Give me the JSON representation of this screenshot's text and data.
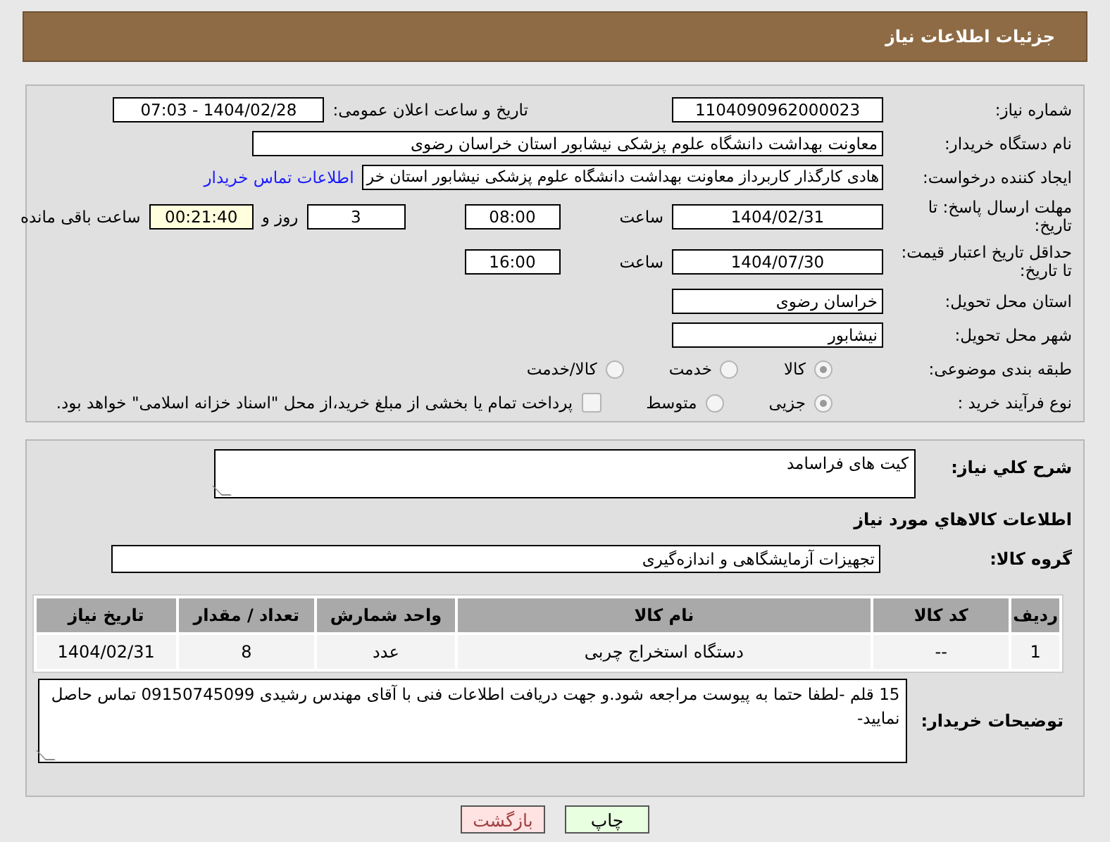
{
  "header": {
    "title": "جزئیات اطلاعات نیاز"
  },
  "need_number": {
    "label": "شماره نیاز:",
    "value": "1104090962000023"
  },
  "announce": {
    "label": "تاریخ و ساعت اعلان عمومی:",
    "value": "1404/02/28 - 07:03"
  },
  "buyer": {
    "label": "نام دستگاه خریدار:",
    "value": "معاونت بهداشت دانشگاه علوم پزشکی نیشابور استان خراسان رضوی"
  },
  "requester": {
    "label": "ایجاد کننده درخواست:",
    "value": "هادی کارگذار کاربرداز معاونت بهداشت دانشگاه علوم پزشکی نیشابور استان خر",
    "link": "اطلاعات تماس خریدار"
  },
  "deadline": {
    "label": "مهلت ارسال پاسخ: تا تاریخ:",
    "date": "1404/02/31",
    "time_label": "ساعت",
    "time": "08:00",
    "days": "3",
    "days_label": "روز و",
    "remaining": "00:21:40",
    "remaining_label": "ساعت باقی مانده"
  },
  "validity": {
    "label": "حداقل تاریخ اعتبار قیمت: تا تاریخ:",
    "date": "1404/07/30",
    "time_label": "ساعت",
    "time": "16:00"
  },
  "province": {
    "label": "استان محل تحویل:",
    "value": "خراسان رضوی"
  },
  "city": {
    "label": "شهر محل تحویل:",
    "value": "نیشابور"
  },
  "category": {
    "label": "طبقه بندی موضوعی:",
    "options": [
      {
        "label": "کالا",
        "selected": true
      },
      {
        "label": "خدمت",
        "selected": false
      },
      {
        "label": "کالا/خدمت",
        "selected": false
      }
    ]
  },
  "process": {
    "label": "نوع فرآیند خرید :",
    "options": [
      {
        "label": "جزیی",
        "selected": true
      },
      {
        "label": "متوسط",
        "selected": false
      }
    ],
    "payment": {
      "label": "پرداخت تمام یا بخشی از مبلغ خرید،از محل \"اسناد خزانه اسلامی\" خواهد بود.",
      "checked": false
    }
  },
  "description": {
    "label": "شرح کلي نياز:",
    "value": "کیت های فراسامد"
  },
  "goods_heading": "اطلاعات کالاهاي مورد نياز",
  "goods_group": {
    "label": "گروه کالا:",
    "value": "تجهیزات آزمایشگاهی و اندازه‌گیری"
  },
  "table": {
    "columns": [
      "ردیف",
      "کد کالا",
      "نام کالا",
      "واحد شمارش",
      "تعداد / مقدار",
      "تاریخ نیاز"
    ],
    "rows": [
      [
        "1",
        "--",
        "دستگاه استخراج چربی",
        "عدد",
        "8",
        "1404/02/31"
      ]
    ]
  },
  "notes": {
    "label": "توضیحات خریدار:",
    "value": "15 قلم -لطفا حتما به پیوست مراجعه شود.و جهت دریافت اطلاعات فنی با آقای مهندس رشیدی 09150745099 تماس حاصل نمایید-"
  },
  "buttons": [
    {
      "label": "چاپ",
      "kind": "print"
    },
    {
      "label": "بازگشت",
      "kind": "back"
    }
  ]
}
